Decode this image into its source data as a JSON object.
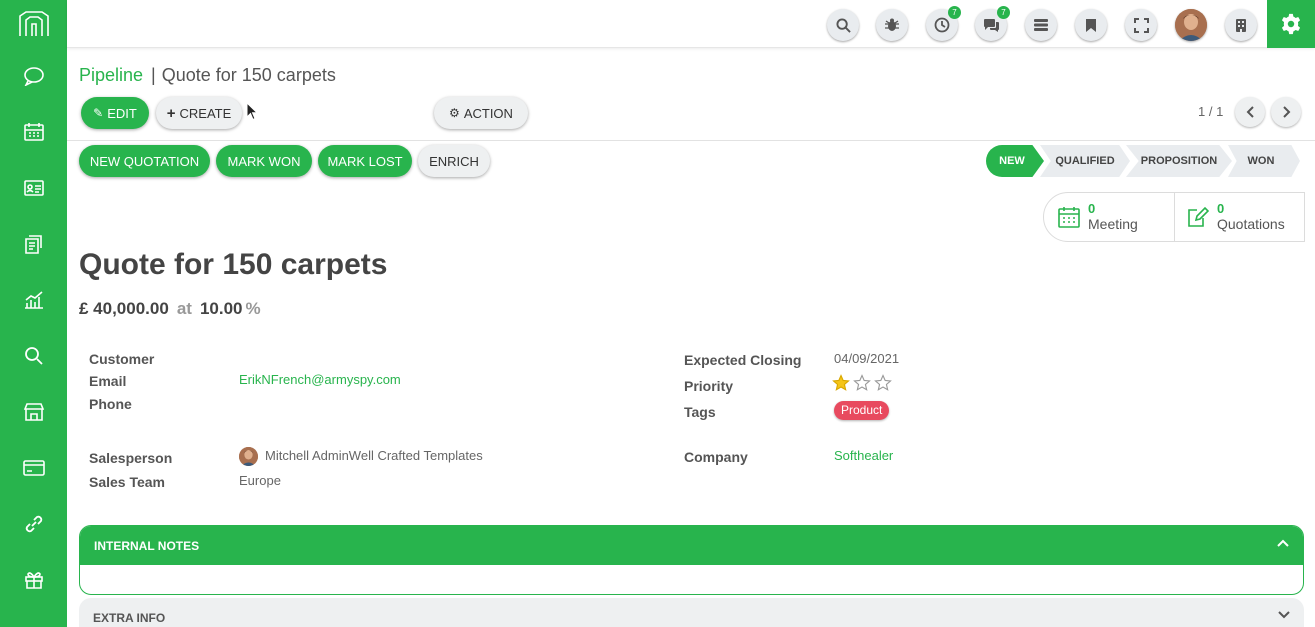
{
  "colors": {
    "brand": "#28b44d",
    "tag": "#e84a5f",
    "star": "#f5c518"
  },
  "sidebar": {
    "logo": "logo-icon",
    "items": [
      {
        "icon": "discuss-icon"
      },
      {
        "icon": "calendar-icon"
      },
      {
        "icon": "contacts-icon"
      },
      {
        "icon": "crm-icon"
      },
      {
        "icon": "sales-chart-icon"
      },
      {
        "icon": "search-icon"
      },
      {
        "icon": "shop-icon"
      },
      {
        "icon": "card-icon"
      },
      {
        "icon": "link-icon"
      },
      {
        "icon": "gift-icon"
      }
    ]
  },
  "topbar": {
    "activity_badge": "7",
    "messages_badge": "7"
  },
  "breadcrumb": {
    "parent": "Pipeline",
    "separator": "|",
    "current": "Quote for 150 carpets"
  },
  "toolbar": {
    "edit": "EDIT",
    "create": "CREATE",
    "action": "ACTION"
  },
  "pager": {
    "value": "1 / 1"
  },
  "header_buttons": {
    "new_quotation": "NEW QUOTATION",
    "mark_won": "MARK WON",
    "mark_lost": "MARK LOST",
    "enrich": "ENRICH"
  },
  "stages": {
    "new": "NEW",
    "qualified": "QUALIFIED",
    "proposition": "PROPOSITION",
    "won": "WON",
    "current": "NEW"
  },
  "smart": {
    "meeting_count": "0",
    "meeting_label": "Meeting",
    "quotations_count": "0",
    "quotations_label": "Quotations"
  },
  "record": {
    "title": "Quote for 150 carpets",
    "expected_revenue": "£ 40,000.00",
    "at": "at",
    "probability": "10.00",
    "percent": "%"
  },
  "fields": {
    "customer_label": "Customer",
    "customer_value": "",
    "email_label": "Email",
    "email_value": "ErikNFrench@armyspy.com",
    "phone_label": "Phone",
    "phone_value": "",
    "salesperson_label": "Salesperson",
    "salesperson_value": "Mitchell AdminWell Crafted Templates",
    "sales_team_label": "Sales Team",
    "sales_team_value": "Europe",
    "expected_closing_label": "Expected Closing",
    "expected_closing_value": "04/09/2021",
    "priority_label": "Priority",
    "priority_stars": 1,
    "priority_max": 3,
    "tags_label": "Tags",
    "tag_value": "Product",
    "company_label": "Company",
    "company_value": "Softhealer"
  },
  "sections": {
    "internal_notes": "INTERNAL NOTES",
    "extra_info": "EXTRA INFO"
  }
}
